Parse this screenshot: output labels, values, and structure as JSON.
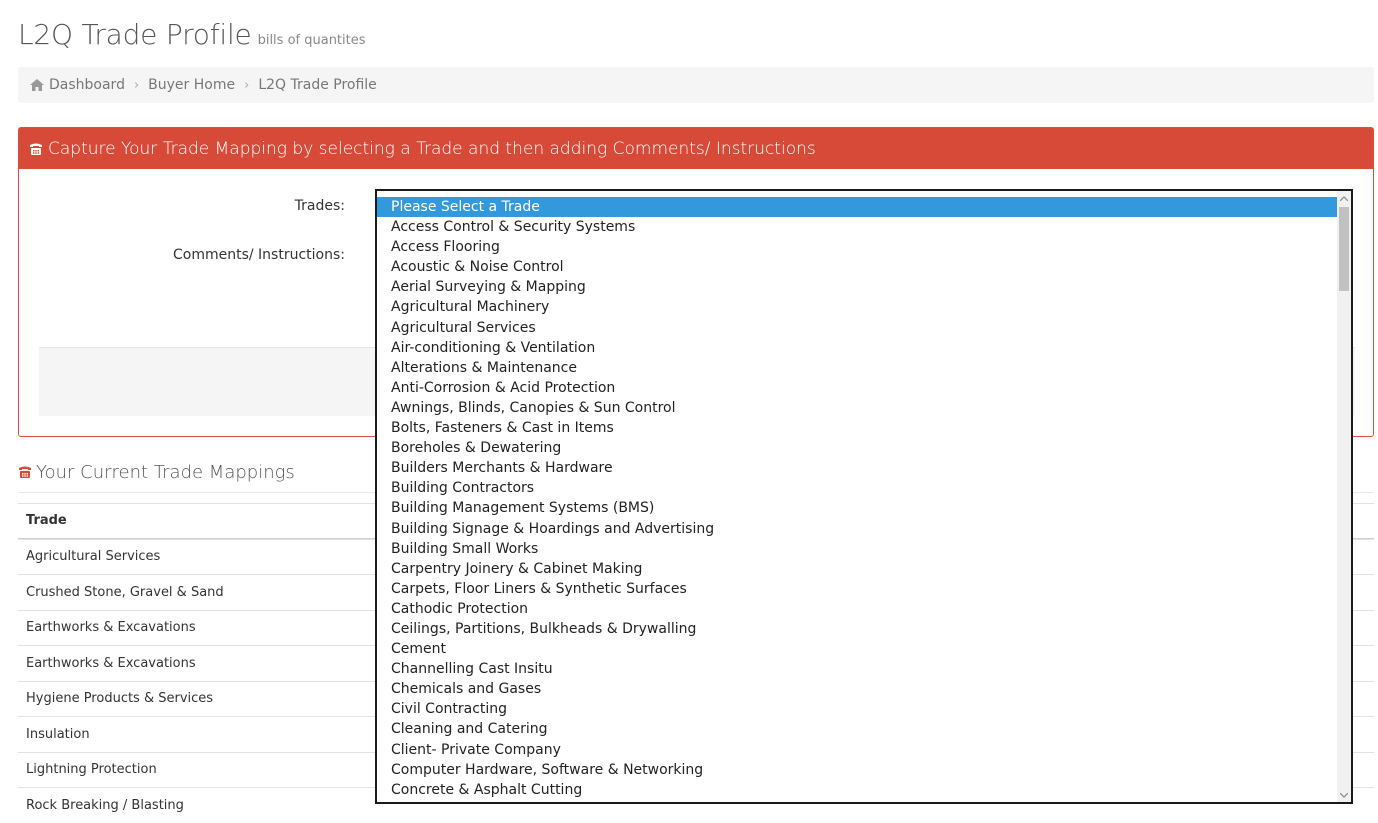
{
  "page": {
    "title": "L2Q Trade Profile",
    "subtitle": "bills of quantites"
  },
  "breadcrumb": {
    "icon": "home-icon",
    "items": [
      "Dashboard",
      "Buyer Home",
      "L2Q Trade Profile"
    ]
  },
  "panel": {
    "icon": "phone-icon",
    "heading": "Capture Your Trade Mapping by selecting a Trade and then adding Comments/ Instructions",
    "accent_color": "#d84a38",
    "trades_label": "Trades:",
    "comments_label": "Comments/ Instructions:"
  },
  "mappings": {
    "icon": "phone-icon",
    "heading": "Your Current Trade Mappings",
    "column_trade": "Trade",
    "rows": [
      "Agricultural Services",
      "Crushed Stone, Gravel & Sand",
      "Earthworks & Excavations",
      "Earthworks & Excavations",
      "Hygiene Products & Services",
      "Insulation",
      "Lightning Protection",
      "Rock Breaking / Blasting"
    ]
  },
  "trade_select": {
    "selected_color": "#3399dd",
    "options": [
      "Please Select a Trade",
      "Access Control & Security Systems",
      "Access Flooring",
      "Acoustic & Noise Control",
      "Aerial Surveying & Mapping",
      "Agricultural Machinery",
      "Agricultural Services",
      "Air-conditioning & Ventilation",
      "Alterations & Maintenance",
      "Anti-Corrosion & Acid Protection",
      "Awnings, Blinds, Canopies & Sun Control",
      "Bolts, Fasteners & Cast in Items",
      "Boreholes & Dewatering",
      "Builders Merchants & Hardware",
      "Building Contractors",
      "Building Management Systems (BMS)",
      "Building Signage & Hoardings and Advertising",
      "Building Small Works",
      "Carpentry Joinery & Cabinet Making",
      "Carpets, Floor Liners & Synthetic Surfaces",
      "Cathodic Protection",
      "Ceilings, Partitions, Bulkheads & Drywalling",
      "Cement",
      "Channelling Cast Insitu",
      "Chemicals and Gases",
      "Civil Contracting",
      "Cleaning and Catering",
      "Client- Private Company",
      "Computer Hardware, Software & Networking",
      "Concrete & Asphalt Cutting"
    ]
  }
}
